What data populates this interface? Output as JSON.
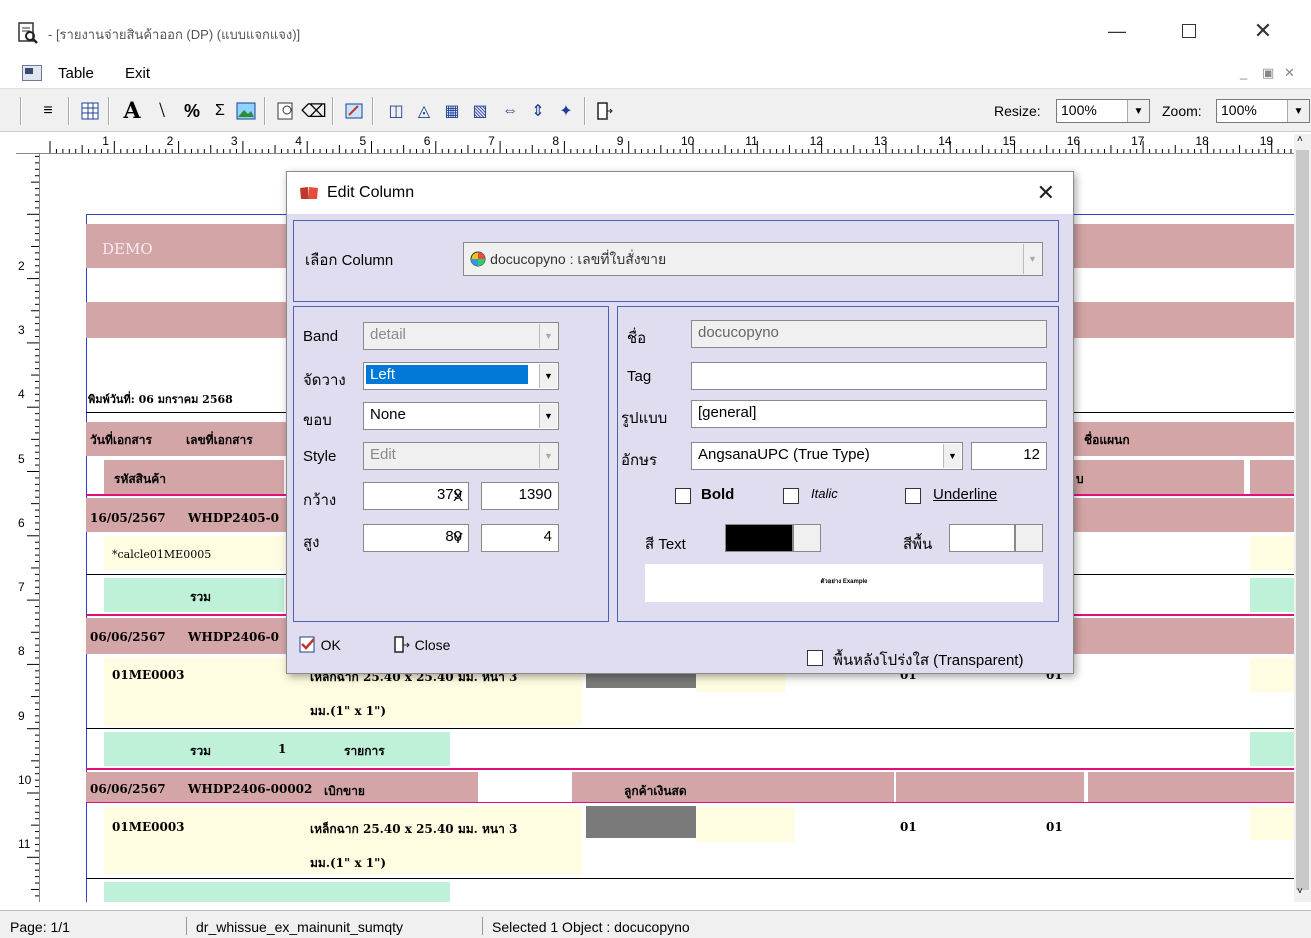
{
  "window": {
    "title": "- [รายงานจ่ายสินค้าออก (DP) (แบบแจกแจง)]"
  },
  "menu": {
    "table": "Table",
    "exit": "Exit"
  },
  "toolbar": {
    "resize_label": "Resize:",
    "resize_value": "100%",
    "zoom_label": "Zoom:",
    "zoom_value": "100%"
  },
  "ruler": {
    "h": [
      "1",
      "2",
      "3",
      "4",
      "5",
      "6",
      "7",
      "8",
      "9",
      "10",
      "11",
      "12",
      "13",
      "14",
      "15",
      "16",
      "17",
      "18",
      "19",
      "2"
    ],
    "v": [
      "2",
      "3",
      "4",
      "5",
      "6",
      "7",
      "8",
      "9",
      "10",
      "11"
    ]
  },
  "report": {
    "demo": "DEMO",
    "print_date": "พิมพ์วันที่: 06 มกราคม 2568",
    "hdr_date": "วันที่เอกสาร",
    "hdr_doc": "เลขที่เอกสาร",
    "hdr_dept": "ชื่อแผนก",
    "hdr_code": "รหัสสินค้า",
    "hdr_right": "บ",
    "r1_date": "16/05/2567",
    "r1_doc": "WHDP2405-0",
    "r1_item": "*calcle01ME0005",
    "sum_label": "รวม",
    "sum_count": "1",
    "sum_unit": "รายการ",
    "r2_date": "06/06/2567",
    "r2_doc": "WHDP2406-0",
    "r2_item": "01ME0003",
    "r2_desc1": "เหล็กฉาก 25.40 x 25.40 มม. หนา 3",
    "r2_desc2": "มม.(1\" x 1\")",
    "r2_c1": "01",
    "r2_c2": "01",
    "r3_date": "06/06/2567",
    "r3_doc": "WHDP2406-00002",
    "r3_type": "เบิกขาย",
    "r3_cust": "ลูกค้าเงินสด",
    "r3_item": "01ME0003",
    "r3_desc1": "เหล็กฉาก 25.40 x 25.40 มม. หนา 3",
    "r3_desc2": "มม.(1\" x 1\")",
    "r3_c1": "01",
    "r3_c2": "01"
  },
  "status": {
    "page": "Page: 1/1",
    "table": "dr_whissue_ex_mainunit_sumqty",
    "selected": "Selected 1 Object : docucopyno"
  },
  "dialog": {
    "title": "Edit Column",
    "select_column_label": "เลือก Column",
    "select_column_value": "docucopyno : เลขที่ใบสั่งขาย",
    "band_label": "Band",
    "band_value": "detail",
    "align_label": "จัดวาง",
    "align_value": "Left",
    "border_label": "ขอบ",
    "border_value": "None",
    "style_label": "Style",
    "style_value": "Edit",
    "width_label": "กว้าง",
    "width_value": "379",
    "x_label": "X",
    "x_value": "1390",
    "height_label": "สูง",
    "height_value": "80",
    "y_label": "Y",
    "y_value": "4",
    "name_label": "ชื่อ",
    "name_value": "docucopyno",
    "tag_label": "Tag",
    "tag_value": "",
    "format_label": "รูปแบบ",
    "format_value": "[general]",
    "font_label": "อักษร",
    "font_value": "AngsanaUPC (True Type)",
    "font_size": "12",
    "bold_label": "Bold",
    "italic_label": "Italic",
    "underline_label": "Underline",
    "text_color_label": "สี Text",
    "bg_color_label": "สีพื้น",
    "preview_text": "ตัวอย่าง Example",
    "ok_label": "OK",
    "close_label": "Close",
    "transparent_label": "พื้นหลังโปร่งใส (Transparent)",
    "text_color": "#000000",
    "bg_color": "#ffffff"
  }
}
